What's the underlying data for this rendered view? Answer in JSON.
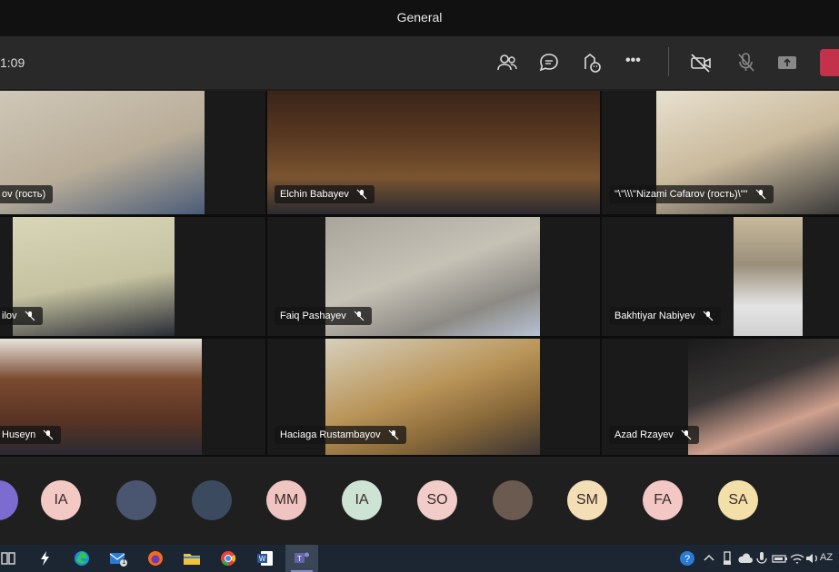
{
  "window": {
    "title": "General"
  },
  "toolbar": {
    "timer": "1:09",
    "icons": [
      "participants-icon",
      "chat-icon",
      "reactions-icon",
      "more-icon",
      "camera-off-icon",
      "mic-off-icon",
      "share-icon",
      "leave-icon"
    ],
    "more_label": "•••"
  },
  "tiles": [
    {
      "name": "ov (гость)",
      "muted": false
    },
    {
      "name": "Elchin Babayev",
      "muted": true
    },
    {
      "name": "\"\\\"\\\\\\\"Nizami Cəfarov (гость)\\\"\"",
      "muted": true
    },
    {
      "name": "ilov",
      "muted": true
    },
    {
      "name": "Faiq Pashayev",
      "muted": true
    },
    {
      "name": "Bakhtiyar Nabiyev",
      "muted": true
    },
    {
      "name": "Huseyn",
      "muted": true
    },
    {
      "name": "Haciaga Rustambayov",
      "muted": true
    },
    {
      "name": "Azad Rzayev",
      "muted": true
    }
  ],
  "strip": {
    "avatars": [
      {
        "initials": "",
        "color": "#7c6cd0"
      },
      {
        "initials": "IA",
        "color": "#f3c9c5"
      },
      {
        "initials": "",
        "color": "#4a5570"
      },
      {
        "initials": "",
        "color": "#3c4a60"
      },
      {
        "initials": "MM",
        "color": "#f0c5c1"
      },
      {
        "initials": "IA",
        "color": "#cde3d3"
      },
      {
        "initials": "SO",
        "color": "#f1ccc8"
      },
      {
        "initials": "",
        "color": "#6a5a50"
      },
      {
        "initials": "SM",
        "color": "#f3deb5"
      },
      {
        "initials": "FA",
        "color": "#f3c7c4"
      },
      {
        "initials": "SA",
        "color": "#f3e0a8"
      }
    ]
  },
  "taskbar": {
    "apps": [
      "task-view-icon",
      "lightning-app-icon",
      "edge-icon",
      "mail-icon",
      "firefox-icon",
      "file-explorer-icon",
      "chrome-icon",
      "word-icon",
      "teams-icon"
    ],
    "mail_badge": "1",
    "tray_lang": "AZ"
  },
  "colors": {
    "accent": "#c4314b",
    "teams": "#6264a7"
  }
}
